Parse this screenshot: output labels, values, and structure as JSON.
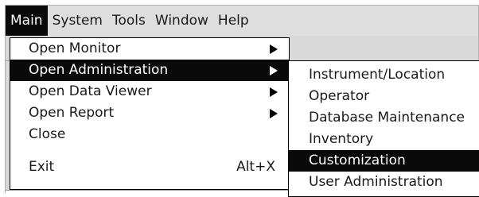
{
  "menubar": {
    "items": [
      {
        "label": "Main",
        "active": true
      },
      {
        "label": "System",
        "active": false
      },
      {
        "label": "Tools",
        "active": false
      },
      {
        "label": "Window",
        "active": false
      },
      {
        "label": "Help",
        "active": false
      }
    ]
  },
  "main_menu": {
    "items": [
      {
        "label": "Open Monitor",
        "has_submenu": true
      },
      {
        "label": "Open Administration",
        "has_submenu": true,
        "highlighted": true
      },
      {
        "label": "Open Data Viewer",
        "has_submenu": true
      },
      {
        "label": "Open Report",
        "has_submenu": true
      },
      {
        "label": "Close"
      },
      {
        "label": "Exit",
        "shortcut": "Alt+X"
      }
    ]
  },
  "admin_submenu": {
    "items": [
      {
        "label": "Instrument/Location"
      },
      {
        "label": "Operator"
      },
      {
        "label": "Database Maintenance"
      },
      {
        "label": "Inventory"
      },
      {
        "label": "Customization",
        "highlighted": true
      },
      {
        "label": "User Administration"
      }
    ]
  },
  "colors": {
    "highlight_bg": "#0a0a0a",
    "highlight_fg": "#ffffff",
    "menubar_bg": "#dedede"
  }
}
